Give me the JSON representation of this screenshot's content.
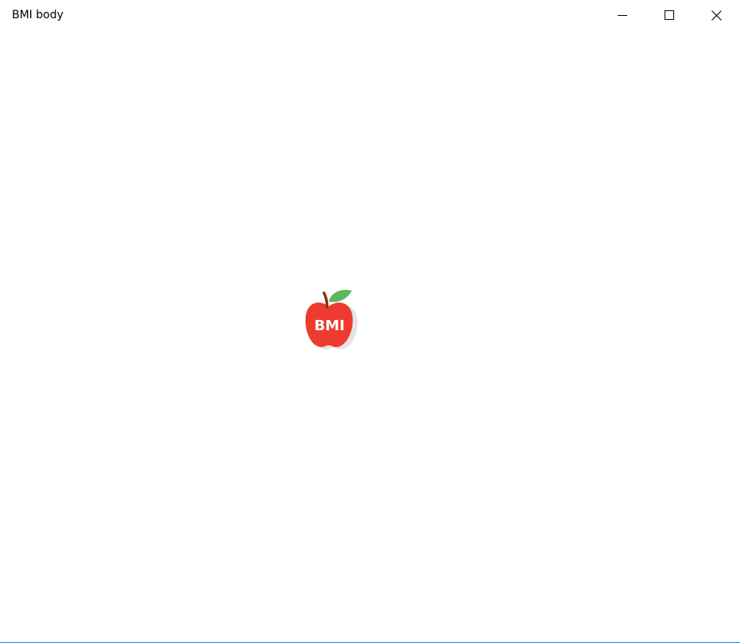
{
  "window": {
    "title": "BMI body",
    "controls": {
      "minimize": "minimize-icon",
      "maximize": "maximize-icon",
      "close": "close-icon"
    },
    "accent_border_color": "#2b87d8"
  },
  "splash": {
    "logo_text": "BMI",
    "logo_icon": "apple-icon",
    "colors": {
      "apple": "#ee3b2f",
      "leaf": "#5cb860",
      "stem": "#8b2a12",
      "shadow": "#e4e4e4"
    }
  }
}
